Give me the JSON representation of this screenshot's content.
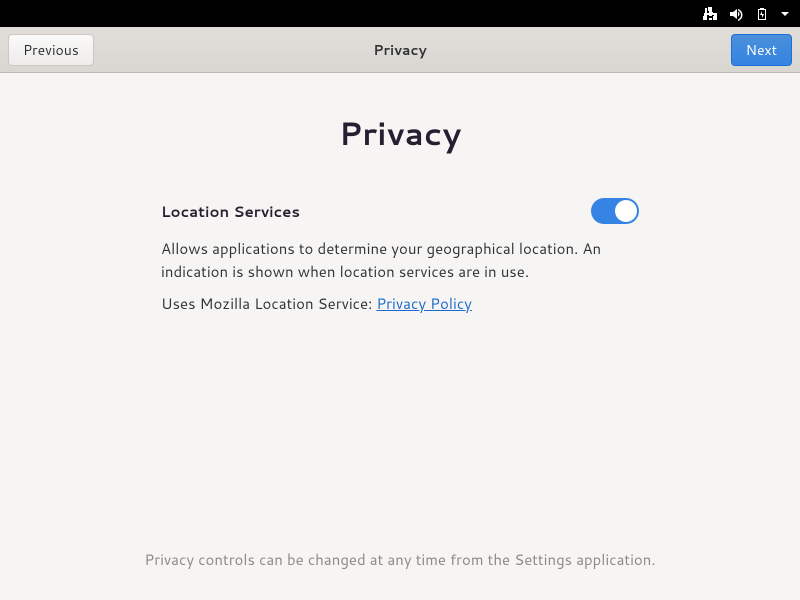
{
  "header": {
    "title": "Privacy",
    "previous_label": "Previous",
    "next_label": "Next"
  },
  "page": {
    "heading": "Privacy"
  },
  "location_services": {
    "label": "Location Services",
    "enabled": true,
    "description": "Allows applications to determine your geographical location. An indication is shown when location services are in use.",
    "provider_prefix": "Uses Mozilla Location Service: ",
    "privacy_link_text": "Privacy Policy"
  },
  "footer": {
    "note": "Privacy controls can be changed at any time from the Settings application."
  },
  "tray": {
    "icons": [
      "network-icon",
      "volume-icon",
      "battery-icon",
      "dropdown-icon"
    ]
  }
}
